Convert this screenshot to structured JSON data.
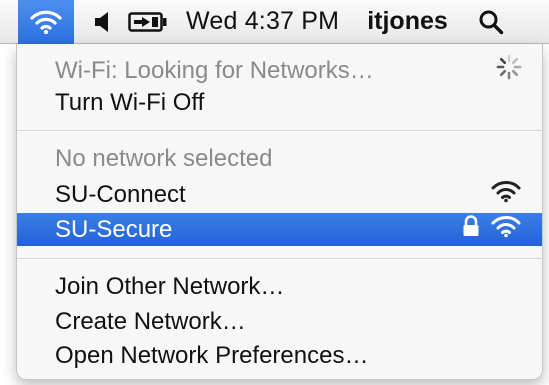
{
  "menubar": {
    "wifi_icon": "wifi-icon",
    "volume_icon": "speaker-icon",
    "battery_icon": "battery-charging-icon",
    "clock": "Wed 4:37 PM",
    "user": "itjones",
    "spotlight_icon": "magnifying-glass-icon"
  },
  "menu": {
    "status": "Wi-Fi: Looking for Networks…",
    "turn_off": "Turn Wi-Fi Off",
    "no_network": "No network selected",
    "networks": [
      {
        "name": "SU-Connect",
        "locked": false,
        "signal_icon": "wifi-signal-icon"
      },
      {
        "name": "SU-Secure",
        "locked": true,
        "signal_icon": "wifi-signal-icon",
        "lock_icon": "lock-icon"
      }
    ],
    "join_other": "Join Other Network…",
    "create_network": "Create Network…",
    "open_prefs": "Open Network Preferences…"
  },
  "colors": {
    "highlight": "#2a6fe0",
    "disabled_text": "#8a8a8a"
  }
}
